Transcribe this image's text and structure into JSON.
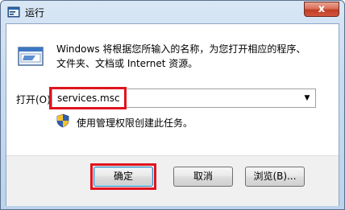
{
  "window": {
    "title": "运行",
    "close_glyph": "x"
  },
  "description": {
    "line1": "Windows 将根据您所输入的名称，为您打开相应的程序、",
    "line2": "文件夹、文档或 Internet 资源。"
  },
  "open_field": {
    "label": "打开(O):",
    "value": "services.msc",
    "dropdown_glyph": "▼"
  },
  "admin_note": "使用管理权限创建此任务。",
  "buttons": {
    "ok": "确定",
    "cancel": "取消",
    "browse": "浏览(B)..."
  },
  "icons": {
    "app": "run-app-icon",
    "run": "run-dialog-icon",
    "shield": "uac-shield-icon",
    "close": "close-icon",
    "dropdown": "chevron-down-icon"
  },
  "colors": {
    "highlight": "#e0141e",
    "close_button": "#c13e26",
    "title_gradient_top": "#d9e7f5",
    "footer_bg": "#f0f0f0"
  }
}
